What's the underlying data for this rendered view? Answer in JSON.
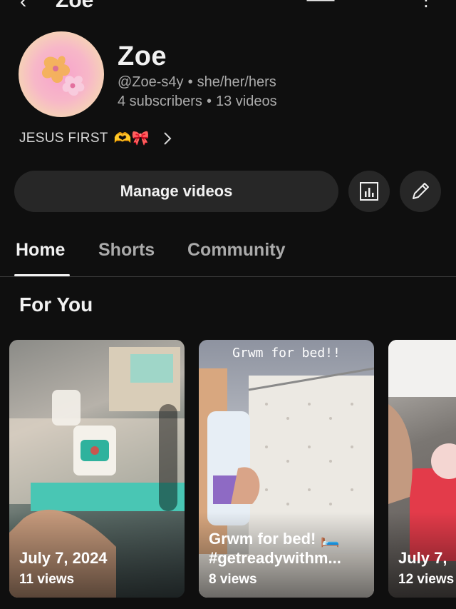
{
  "header": {
    "title": "Zoe"
  },
  "channel": {
    "name": "Zoe",
    "handle": "@Zoe-s4y",
    "pronouns": "she/her/hers",
    "subscribers": "4 subscribers",
    "videos": "13 videos",
    "bio": "JESUS FIRST",
    "bio_emoji": "🫶🎀"
  },
  "actions": {
    "manage_label": "Manage videos"
  },
  "tabs": [
    {
      "label": "Home",
      "active": true
    },
    {
      "label": "Shorts",
      "active": false
    },
    {
      "label": "Community",
      "active": false
    }
  ],
  "section": {
    "title": "For You"
  },
  "shorts": [
    {
      "title": "July 7, 2024",
      "views": "11 views"
    },
    {
      "overlay": "Grwm for bed!!",
      "title_line1": "Grwm for bed! 🛏️",
      "title_line2": "#getreadywithm...",
      "views": "8 views"
    },
    {
      "title": "July 7,",
      "views": "12 views"
    }
  ],
  "colors": {
    "background": "#0f0f0f",
    "button": "#272727",
    "text": "#f1f1f1",
    "secondary_text": "#aaaaaa"
  }
}
